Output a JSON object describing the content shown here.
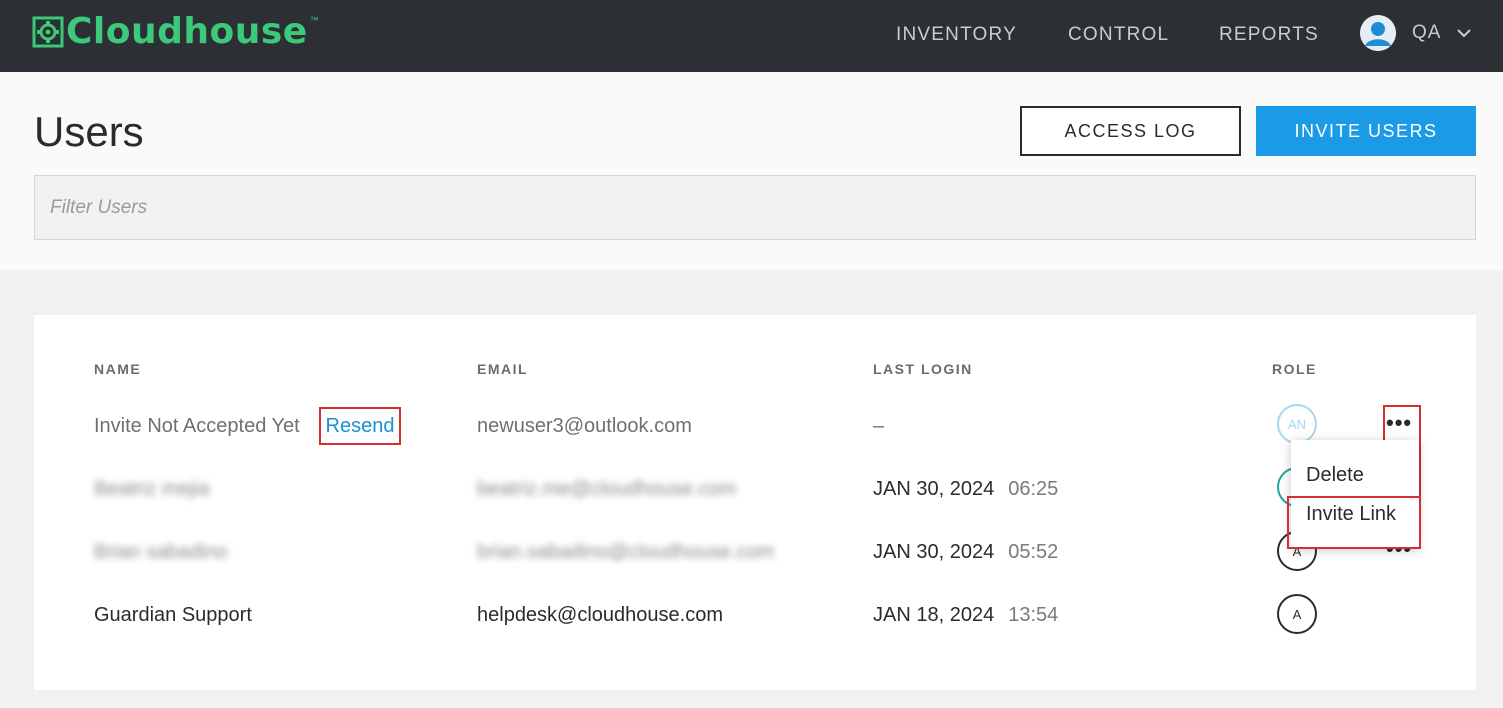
{
  "brand": {
    "name": "Cloudhouse",
    "tm": "™",
    "color": "#3cc97a"
  },
  "nav": {
    "items": [
      {
        "label": "INVENTORY"
      },
      {
        "label": "CONTROL"
      },
      {
        "label": "REPORTS"
      }
    ],
    "user": {
      "name": "QA"
    }
  },
  "page": {
    "title": "Users",
    "access_log_label": "ACCESS LOG",
    "invite_users_label": "INVITE USERS",
    "filter_placeholder": "Filter Users"
  },
  "table": {
    "headers": {
      "name": "NAME",
      "email": "EMAIL",
      "last_login": "LAST LOGIN",
      "role": "ROLE"
    },
    "rows": [
      {
        "name": "Invite Not Accepted Yet",
        "action": "Resend",
        "email": "newuser3@outlook.com",
        "last_login_date": "–",
        "last_login_time": "",
        "role": "AN"
      },
      {
        "name": "Beatriz mejia",
        "email": "beatriz.me@cloudhouse.com",
        "last_login_date": "JAN 30, 2024",
        "last_login_time": "06:25",
        "role": ""
      },
      {
        "name": "Brian sabadino",
        "email": "brian.sabadino@cloudhouse.com",
        "last_login_date": "JAN 30, 2024",
        "last_login_time": "05:52",
        "role": "A"
      },
      {
        "name": "Guardian Support",
        "email": "helpdesk@cloudhouse.com",
        "last_login_date": "JAN 18, 2024",
        "last_login_time": "13:54",
        "role": "A"
      }
    ]
  },
  "row_menu": {
    "items": [
      "Delete",
      "Invite Link"
    ]
  },
  "colors": {
    "accent": "#1b9be6",
    "highlight": "#d32f2f",
    "topbar": "#2c2f33"
  }
}
